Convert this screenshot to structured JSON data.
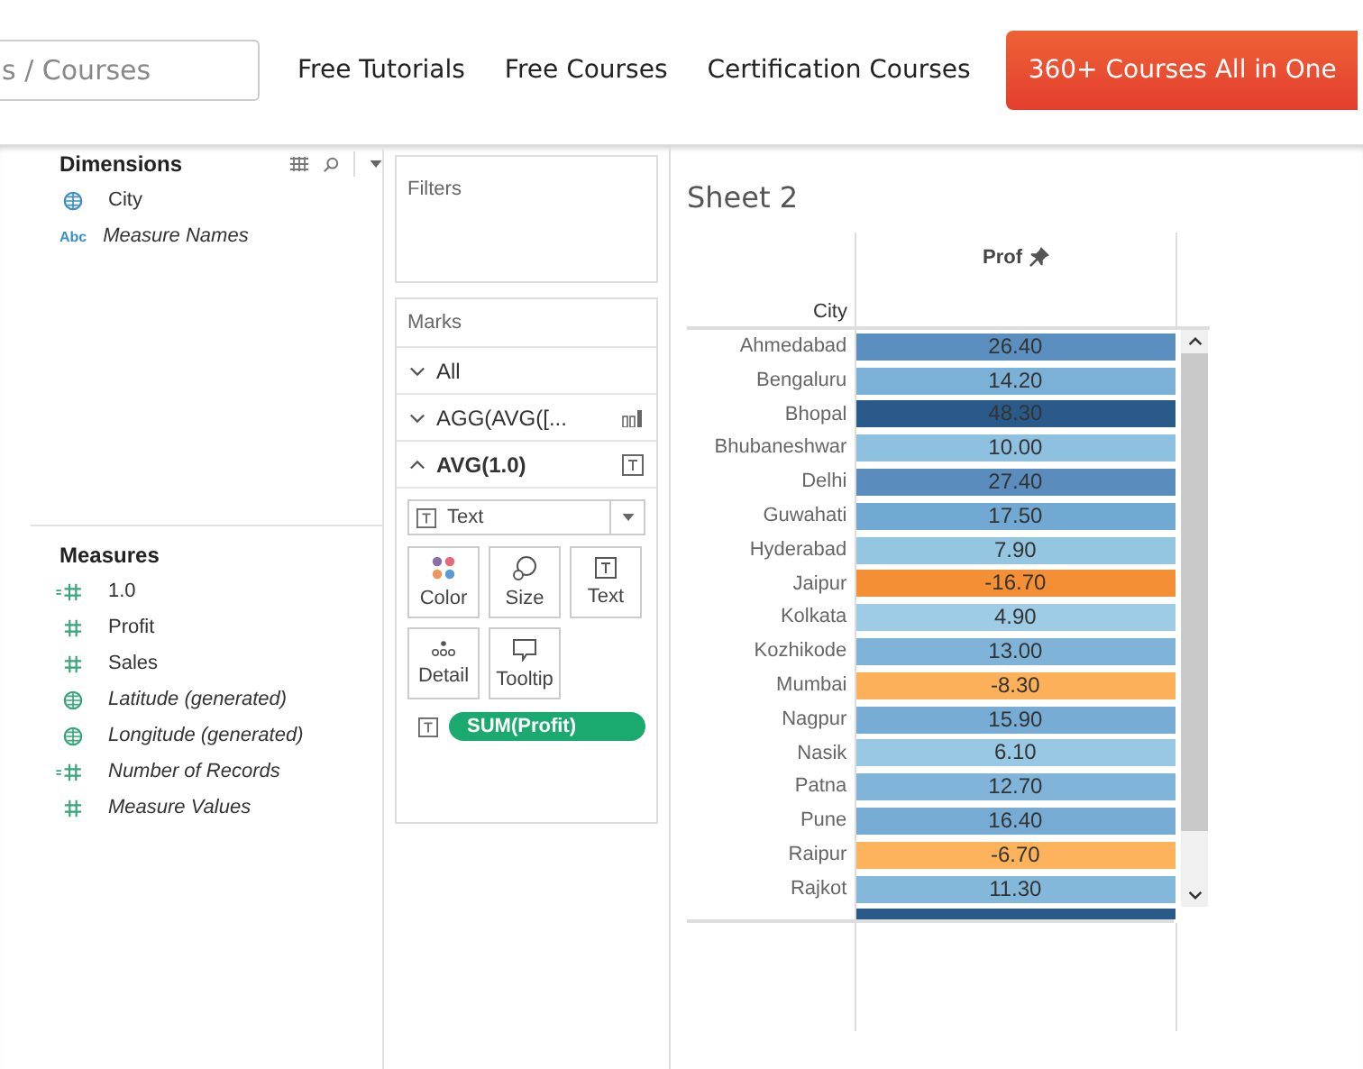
{
  "nav": {
    "search": {
      "placeholder": "s / Courses"
    },
    "links": [
      "Free Tutorials",
      "Free Courses",
      "Certification Courses"
    ],
    "cta": "360+ Courses All in One"
  },
  "dimensions": {
    "title": "Dimensions",
    "items": [
      {
        "kind": "geo",
        "label": "City",
        "generated": false
      },
      {
        "kind": "string",
        "type_label": "Abc",
        "label": "Measure Names",
        "generated": true
      }
    ]
  },
  "measures": {
    "title": "Measures",
    "items": [
      {
        "kind": "calc",
        "label": "1.0",
        "generated": false
      },
      {
        "kind": "number",
        "label": "Profit",
        "generated": false
      },
      {
        "kind": "number",
        "label": "Sales",
        "generated": false
      },
      {
        "kind": "geo",
        "label": "Latitude (generated)",
        "generated": true
      },
      {
        "kind": "geo",
        "label": "Longitude (generated)",
        "generated": true
      },
      {
        "kind": "calc",
        "label": "Number of Records",
        "generated": true
      },
      {
        "kind": "number",
        "label": "Measure Values",
        "generated": true
      }
    ]
  },
  "filters": {
    "title": "Filters"
  },
  "marks": {
    "title": "Marks",
    "cards": [
      {
        "label": "All",
        "expanded": false,
        "kind": "all"
      },
      {
        "label": "AGG(AVG([...",
        "expanded": false,
        "kind": "bar"
      },
      {
        "label": "AVG(1.0)",
        "expanded": true,
        "kind": "text"
      }
    ],
    "mark_type": "Text",
    "buttons": [
      {
        "kind": "color",
        "label": "Color"
      },
      {
        "kind": "size",
        "label": "Size"
      },
      {
        "kind": "text",
        "label": "Text"
      },
      {
        "kind": "detail",
        "label": "Detail"
      },
      {
        "kind": "tooltip",
        "label": "Tooltip"
      }
    ],
    "pill": "SUM(Profit)"
  },
  "sheet": {
    "title": "Sheet 2",
    "row_header": "City",
    "column_header": "Prof",
    "rows": [
      {
        "city": "Ahmedabad",
        "value": "26.40",
        "color": "#5b8fbf"
      },
      {
        "city": "Bengaluru",
        "value": "14.20",
        "color": "#7bb1d6"
      },
      {
        "city": "Bhopal",
        "value": "48.30",
        "color": "#2a5a8a"
      },
      {
        "city": "Bhubaneshwar",
        "value": "10.00",
        "color": "#8ec1df"
      },
      {
        "city": "Delhi",
        "value": "27.40",
        "color": "#5a8dbe"
      },
      {
        "city": "Guwahati",
        "value": "17.50",
        "color": "#72a9d2"
      },
      {
        "city": "Hyderabad",
        "value": "7.90",
        "color": "#94c6e2"
      },
      {
        "city": "Jaipur",
        "value": "-16.70",
        "color": "#f58f35"
      },
      {
        "city": "Kolkata",
        "value": "4.90",
        "color": "#9ecce4"
      },
      {
        "city": "Kozhikode",
        "value": "13.00",
        "color": "#7fb4d8"
      },
      {
        "city": "Mumbai",
        "value": "-8.30",
        "color": "#fdb05a"
      },
      {
        "city": "Nagpur",
        "value": "15.90",
        "color": "#77acd4"
      },
      {
        "city": "Nasik",
        "value": "6.10",
        "color": "#98c8e3"
      },
      {
        "city": "Patna",
        "value": "12.70",
        "color": "#80b4d8"
      },
      {
        "city": "Pune",
        "value": "16.40",
        "color": "#76abd3"
      },
      {
        "city": "Raipur",
        "value": "-6.70",
        "color": "#fdb35c"
      },
      {
        "city": "Rajkot",
        "value": "11.30",
        "color": "#84b8da"
      },
      {
        "color": "#2a5a8a"
      }
    ]
  }
}
